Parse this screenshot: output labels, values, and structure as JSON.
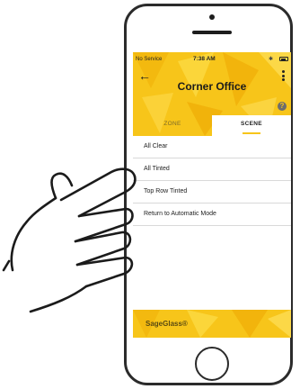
{
  "status_bar": {
    "carrier": "No Service",
    "time": "7:38 AM"
  },
  "header": {
    "title": "Corner Office",
    "back_icon": "arrow-left-icon",
    "menu_icon": "more-vertical-icon",
    "help_icon": "help-icon",
    "help_glyph": "?"
  },
  "tabs": [
    {
      "label": "ZONE",
      "selected": false
    },
    {
      "label": "SCENE",
      "selected": true
    }
  ],
  "scenes": [
    {
      "label": "All Clear"
    },
    {
      "label": "All Tinted"
    },
    {
      "label": "Top Row Tinted"
    },
    {
      "label": "Return to Automatic Mode"
    }
  ],
  "footer": {
    "brand": "SageGlass®"
  },
  "colors": {
    "accent": "#f7c51a",
    "frame": "#2b2b2b"
  }
}
